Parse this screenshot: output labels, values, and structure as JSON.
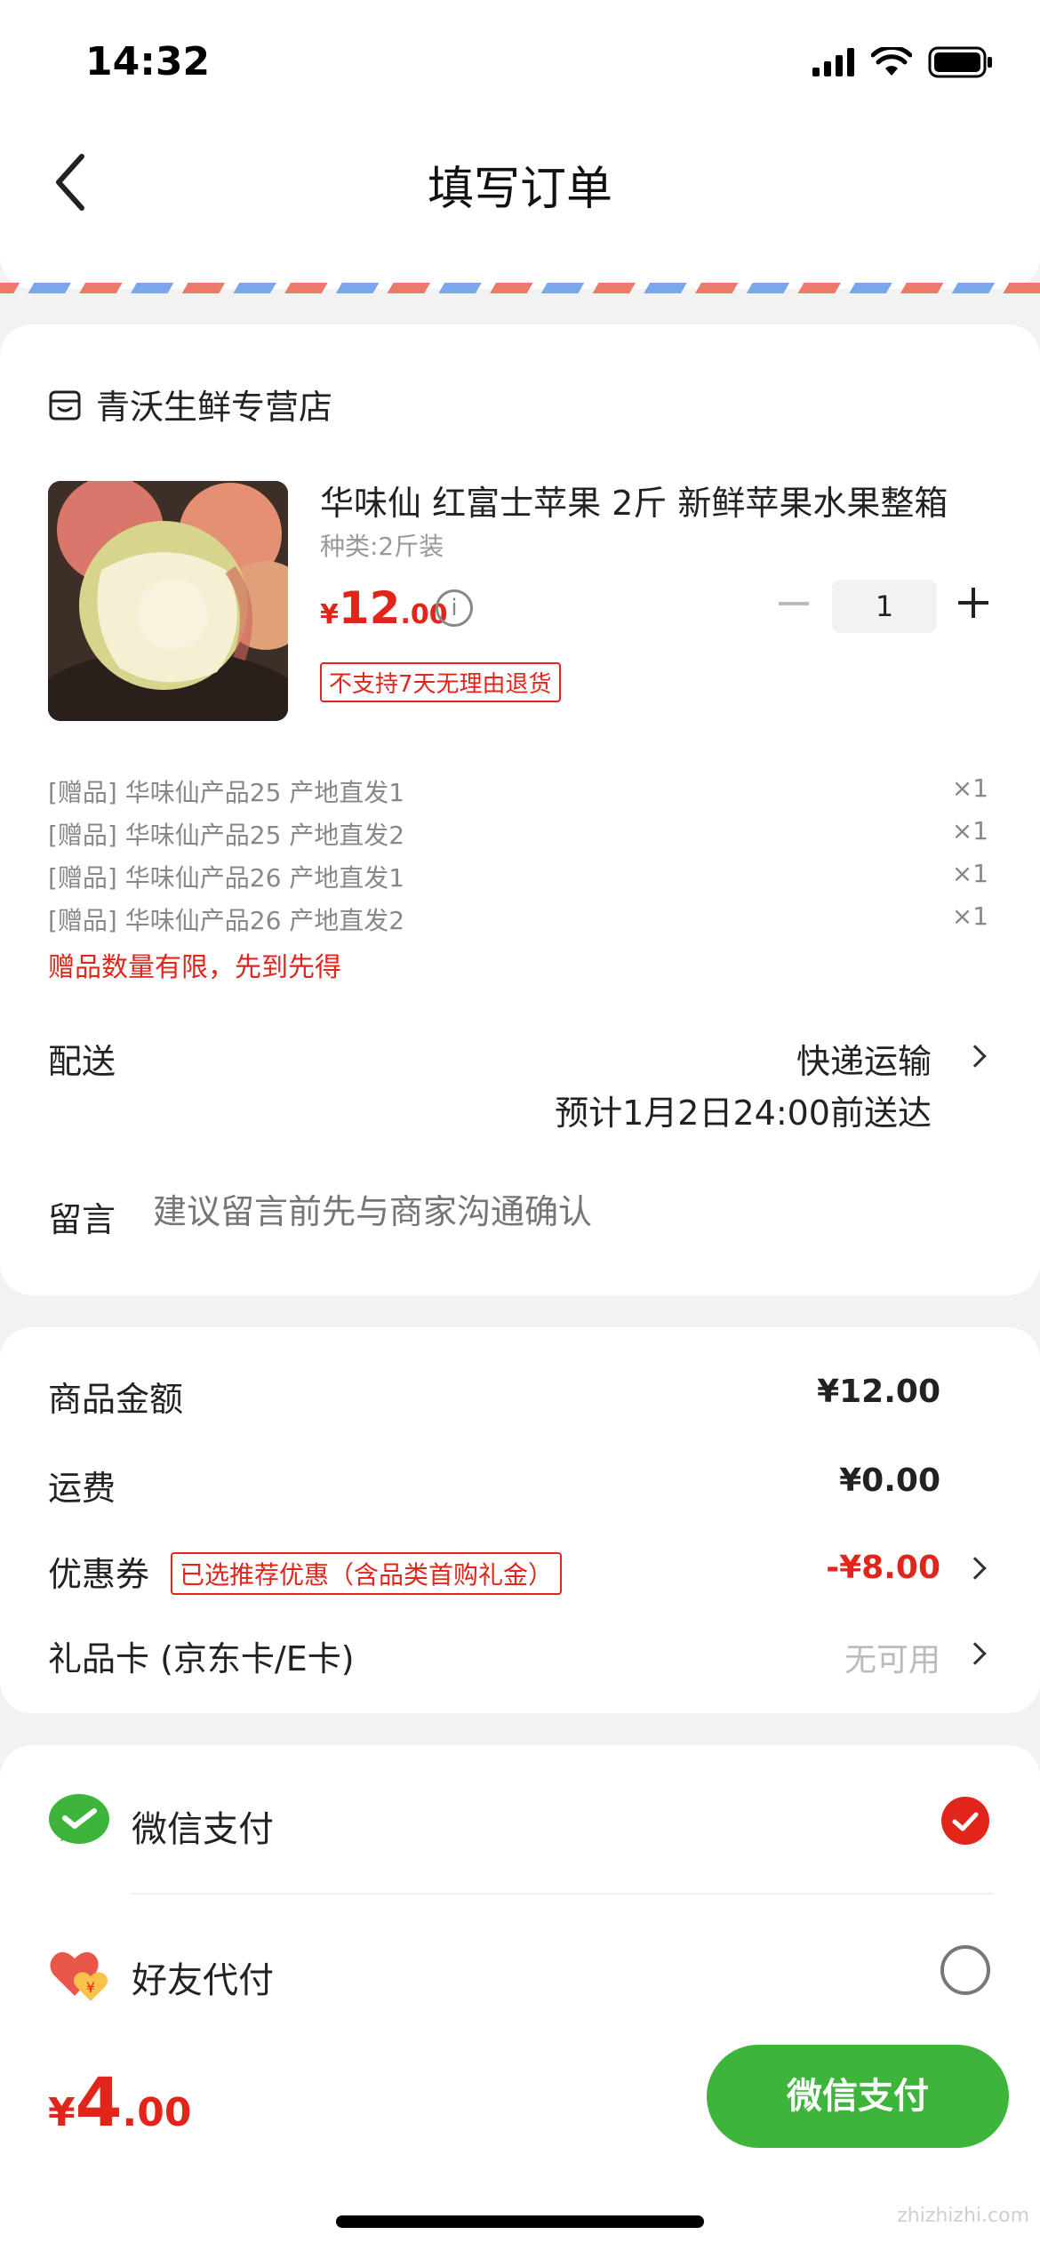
{
  "status_bar": {
    "time": "14:32"
  },
  "header": {
    "title": "填写订单"
  },
  "shop": {
    "name": "青沃生鲜专营店"
  },
  "product": {
    "title": "华味仙 红富士苹果 2斤 新鲜苹果水果整箱",
    "spec": "种类:2斤装",
    "price_currency": "¥",
    "price_int": "12",
    "price_dec": ".00",
    "quantity": "1",
    "return_policy": "不支持7天无理由退货"
  },
  "gifts": [
    {
      "label": "[赠品] 华味仙产品25 产地直发1",
      "count": "×1"
    },
    {
      "label": "[赠品] 华味仙产品25 产地直发2",
      "count": "×1"
    },
    {
      "label": "[赠品] 华味仙产品26 产地直发1",
      "count": "×1"
    },
    {
      "label": "[赠品] 华味仙产品26 产地直发2",
      "count": "×1"
    }
  ],
  "gift_warning": "赠品数量有限，先到先得",
  "delivery": {
    "label": "配送",
    "method": "快递运输",
    "eta": "预计1月2日24:00前送达"
  },
  "note": {
    "label": "留言",
    "placeholder": "建议留言前先与商家沟通确认"
  },
  "summary": {
    "goods_label": "商品金额",
    "goods_amount": "¥12.00",
    "shipping_label": "运费",
    "shipping_amount": "¥0.00",
    "coupon_label": "优惠券",
    "coupon_badge": "已选推荐优惠（含品类首购礼金）",
    "coupon_amount": "-¥8.00",
    "gift_card_label": "礼品卡 (京东卡/E卡)",
    "gift_card_value": "无可用"
  },
  "payment": {
    "options": [
      {
        "label": "微信支付",
        "selected": true
      },
      {
        "label": "好友代付",
        "selected": false
      }
    ]
  },
  "footer": {
    "total_currency": "¥",
    "total_int": "4",
    "total_dec": ".00",
    "pay_button": "微信支付"
  },
  "watermark": "zhizhizhi.com",
  "colors": {
    "accent": "#e1251b",
    "wechat_green": "#3db53a",
    "airmail_red": "#ec7a6b",
    "airmail_blue": "#7aa6ec"
  }
}
